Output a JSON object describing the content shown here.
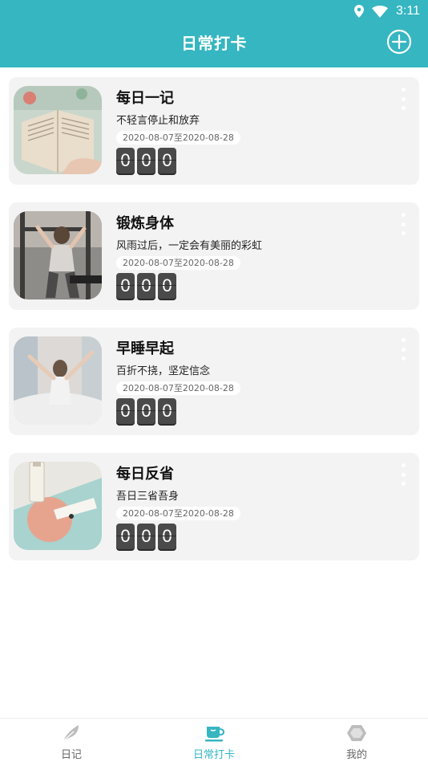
{
  "status_bar": {
    "time": "3:11",
    "icons": [
      "location-icon",
      "wifi-icon"
    ]
  },
  "header": {
    "title": "日常打卡",
    "add_icon": "plus-circle-icon"
  },
  "cards": [
    {
      "title": "每日一记",
      "subtitle": "不轻言停止和放弃",
      "date_range": "2020-08-07至2020-08-28",
      "digits": [
        "0",
        "0",
        "0"
      ],
      "image": "open-book-photo"
    },
    {
      "title": "锻炼身体",
      "subtitle": "风雨过后，一定会有美丽的彩虹",
      "date_range": "2020-08-07至2020-08-28",
      "digits": [
        "0",
        "0",
        "0"
      ],
      "image": "gym-workout-photo"
    },
    {
      "title": "早睡早起",
      "subtitle": "百折不挠，坚定信念",
      "date_range": "2020-08-07至2020-08-28",
      "digits": [
        "0",
        "0",
        "0"
      ],
      "image": "morning-stretch-photo"
    },
    {
      "title": "每日反省",
      "subtitle": "吾日三省吾身",
      "date_range": "2020-08-07至2020-08-28",
      "digits": [
        "0",
        "0",
        "0"
      ],
      "image": "cosmetics-flatlay-photo"
    }
  ],
  "bottom_nav": {
    "items": [
      {
        "label": "日记",
        "icon": "feather-icon",
        "active": false
      },
      {
        "label": "日常打卡",
        "icon": "cup-icon",
        "active": true
      },
      {
        "label": "我的",
        "icon": "hexagon-icon",
        "active": false
      }
    ]
  },
  "colors": {
    "primary": "#35b6c1",
    "card_background": "#f3f3f3",
    "digit_background": "#4a4a4a"
  }
}
